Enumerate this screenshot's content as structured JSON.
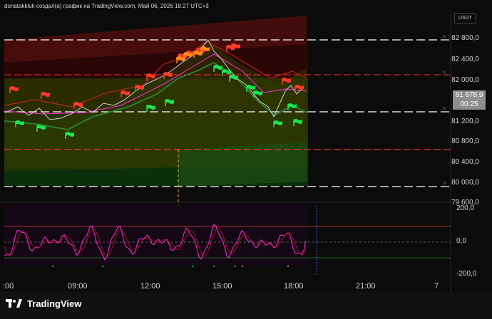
{
  "header": {
    "title": "donatakkluk создал(а) график на TradingView.com, Май 06, 2026 18:27 UTC+3"
  },
  "currency": {
    "label": "USDT"
  },
  "price_axis": {
    "labels": [
      "82 800,0",
      "82 400,0",
      "82 000,0",
      "81 200,0",
      "80 800,0",
      "80 400,0",
      "80 000,0",
      "79 600,0"
    ]
  },
  "price_tag": {
    "price": "81 678,9",
    "countdown": "00:25"
  },
  "level_tags": {
    "tag1": "1d",
    "tag2": "1d",
    "tag3": "1d",
    "tag4": "1d"
  },
  "oscillator_axis": {
    "labels": [
      "200,0",
      "0,0",
      "-200,0"
    ]
  },
  "time_axis": {
    "labels": [
      ":00",
      "09:00",
      "12:00",
      "15:00",
      "18:00",
      "21:00",
      "7"
    ]
  },
  "brand": {
    "name": "TradingView"
  },
  "colors": {
    "bull_flag": "#19e64d",
    "bear_flag": "#ff3a2a",
    "orange_flag": "#ff8a18",
    "level_line_red": "#e53935",
    "level_line_white": "#ffffff",
    "oscillator_magenta": "#ff2be0",
    "price_tag_bg": "#8e8e8e"
  }
}
